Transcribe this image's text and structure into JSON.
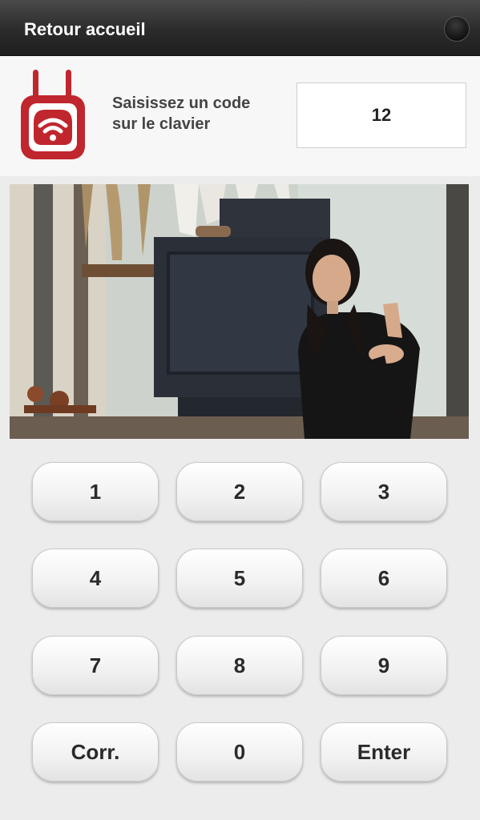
{
  "header": {
    "back_label": "Retour accueil"
  },
  "prompt": {
    "line1": "Saisissez un code",
    "line2": "sur le clavier"
  },
  "code_display": {
    "value": "12"
  },
  "keypad": {
    "k1": "1",
    "k2": "2",
    "k3": "3",
    "k4": "4",
    "k5": "5",
    "k6": "6",
    "k7": "7",
    "k8": "8",
    "k9": "9",
    "correct": "Corr.",
    "k0": "0",
    "enter": "Enter"
  },
  "colors": {
    "brand_red": "#c0262e",
    "topbar": "#2b2b2b"
  }
}
